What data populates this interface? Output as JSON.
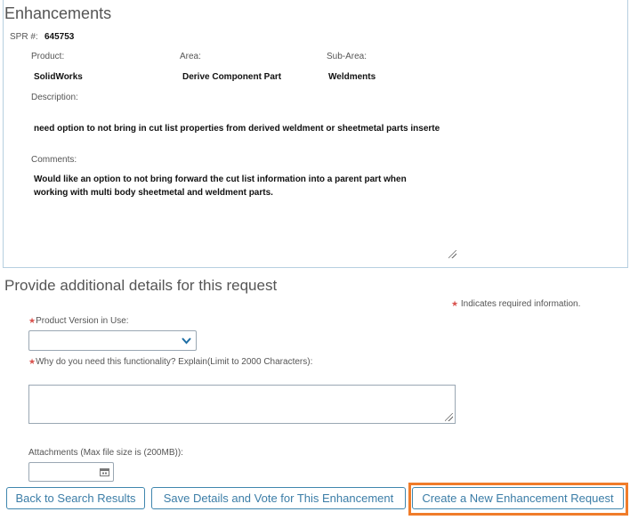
{
  "enhancements": {
    "title": "Enhancements",
    "spr_label": "SPR #:",
    "spr_value": "645753",
    "product_label": "Product:",
    "product_value": "SolidWorks",
    "area_label": "Area:",
    "area_value": "Derive Component Part",
    "subarea_label": "Sub-Area:",
    "subarea_value": "Weldments",
    "description_label": "Description:",
    "description_value": "need option to not bring in cut list properties from derived weldment or sheetmetal parts inserte",
    "comments_label": "Comments:",
    "comments_line1": "Would like an option to not bring forward the cut list information into a parent part when",
    "comments_line2": "working with multi body sheetmetal and weldment parts."
  },
  "details": {
    "title": "Provide additional details for this request",
    "required_note": "Indicates required information.",
    "required_star": "★",
    "version_label": "Product Version in Use:",
    "version_value": "",
    "why_label": "Why do you need this functionality? Explain(Limit to 2000 Characters):",
    "why_value": "",
    "attachments_label": "Attachments (Max file size is (200MB)):",
    "attachments_value": ""
  },
  "buttons": {
    "back": "Back to Search Results",
    "save_vote": "Save Details and Vote for This Enhancement",
    "create_new": "Create a New Enhancement Request"
  },
  "colors": {
    "accent": "#3b7da7",
    "highlight": "#f07c2a",
    "required": "#d9534f"
  }
}
